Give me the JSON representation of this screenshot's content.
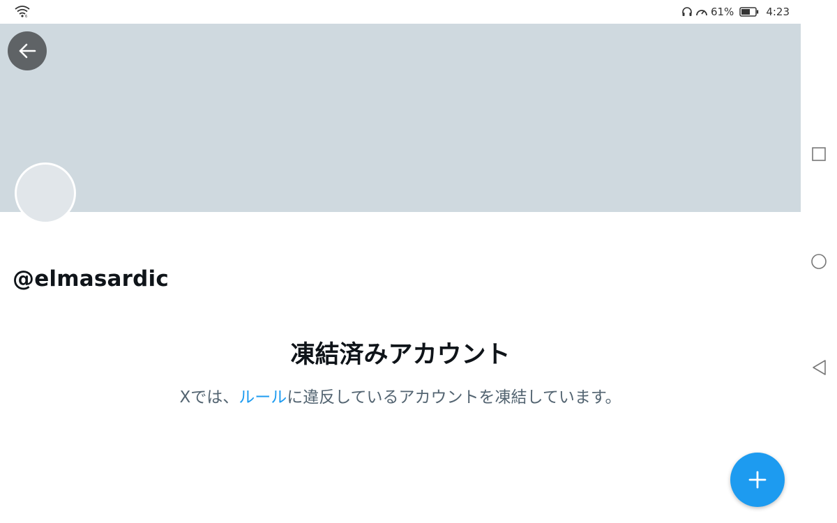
{
  "status_bar": {
    "battery_percent": "61%",
    "time": "4:23",
    "icons": [
      "wifi-icon",
      "headset-icon",
      "speedometer-icon",
      "battery-icon"
    ]
  },
  "profile": {
    "handle": "@elmasardic",
    "banner_color": "#cfd9df",
    "avatar_color": "#e1e6ea"
  },
  "suspended": {
    "title": "凍結済みアカウント",
    "desc_prefix": "Xでは、",
    "rules_link": "ルール",
    "desc_suffix": "に違反しているアカウントを凍結しています。"
  },
  "colors": {
    "accent": "#1d9bf0",
    "text_primary": "#0f1419",
    "text_secondary": "#536471"
  },
  "buttons": {
    "back_icon": "arrow-left-icon",
    "fab_icon": "plus-icon"
  },
  "nav_bar": {
    "icons": [
      "recents-square-icon",
      "home-circle-icon",
      "back-triangle-icon"
    ]
  }
}
